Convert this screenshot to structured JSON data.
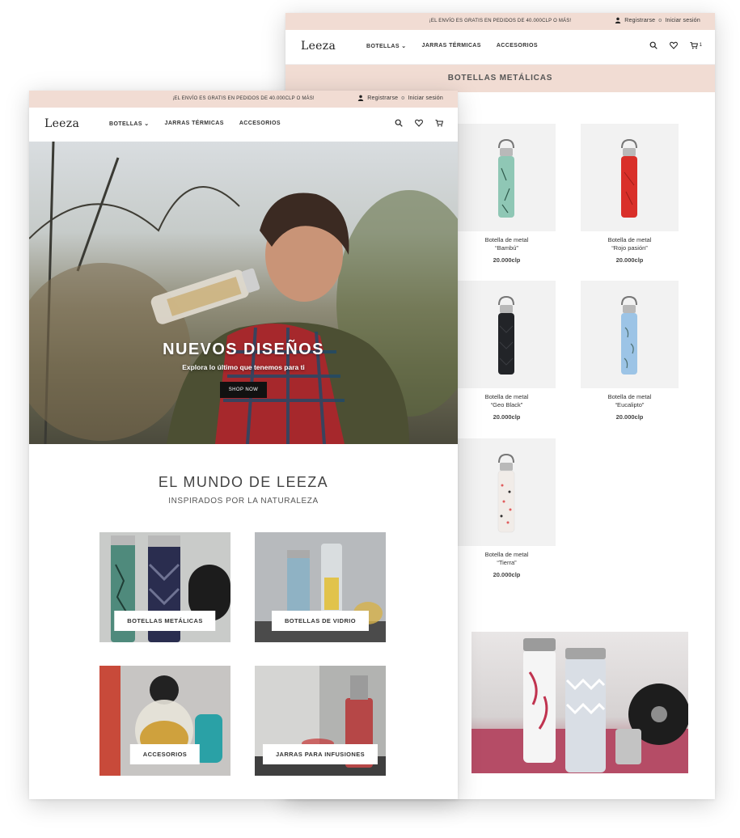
{
  "promo": {
    "message": "¡EL ENVÍO ES GRATIS EN PEDIDOS DE 40.000CLP O MÁS!",
    "register": "Registrarse",
    "or": "o",
    "login": "Iniciar sesión"
  },
  "header": {
    "logo": "Leeza",
    "menu": [
      "BOTELLAS",
      "JARRAS TÉRMICAS",
      "ACCESORIOS"
    ],
    "cart_count": "1"
  },
  "category_page": {
    "title": "BOTELLAS METÁLICAS",
    "products": [
      {
        "name_line1": "Botella de metal",
        "name_line2": "“Bambú”",
        "price": "20.000clp",
        "color": "#8fc7b5"
      },
      {
        "name_line1": "Botella de metal",
        "name_line2": "“Rojo pasión”",
        "price": "20.000clp",
        "color": "#d9302a"
      },
      {
        "name_line1": "Botella de metal",
        "name_line2": "“Geo Black”",
        "price": "20.000clp",
        "color": "#222428"
      },
      {
        "name_line1": "Botella de metal",
        "name_line2": "“Eucalipto”",
        "price": "20.000clp",
        "color": "#9cc4e6"
      },
      {
        "name_line1": "Botella de metal",
        "name_line2": "“Tierra”",
        "price": "20.000clp",
        "color": "#f1ece8"
      }
    ]
  },
  "home": {
    "hero_title": "NUEVOS DISEÑOS",
    "hero_subtitle": "Explora lo último que tenemos para ti",
    "hero_button": "SHOP NOW",
    "section_title": "EL MUNDO DE LEEZA",
    "section_subtitle": "INSPIRADOS POR LA NATURALEZA",
    "tiles": [
      "BOTELLAS METÁLICAS",
      "BOTELLAS DE VIDRIO",
      "ACCESORIOS",
      "JARRAS PARA INFUSIONES"
    ]
  },
  "colors": {
    "accent": "#f1dcd3",
    "button": "#111111"
  }
}
